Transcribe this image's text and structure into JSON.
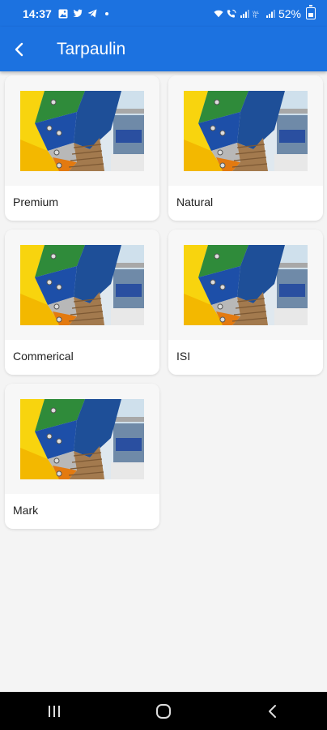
{
  "status_bar": {
    "time": "14:37",
    "battery": "52%",
    "icons": [
      "gallery-icon",
      "twitter-icon",
      "telegram-icon",
      "dot-icon",
      "wifi-icon",
      "wifi-call-icon",
      "signal-icon",
      "volte-icon",
      "signal-icon",
      "battery-icon"
    ]
  },
  "app_bar": {
    "title": "Tarpaulin",
    "back_icon": "back-arrow-icon"
  },
  "colors": {
    "accent": "#1c72e0",
    "background": "#f4f4f4",
    "card": "#ffffff"
  },
  "categories": [
    {
      "label": "Premium"
    },
    {
      "label": "Natural"
    },
    {
      "label": "Commerical"
    },
    {
      "label": "ISI"
    },
    {
      "label": "Mark"
    }
  ],
  "nav_bar": {
    "icons": [
      "recent-apps-icon",
      "home-icon",
      "back-icon"
    ]
  }
}
